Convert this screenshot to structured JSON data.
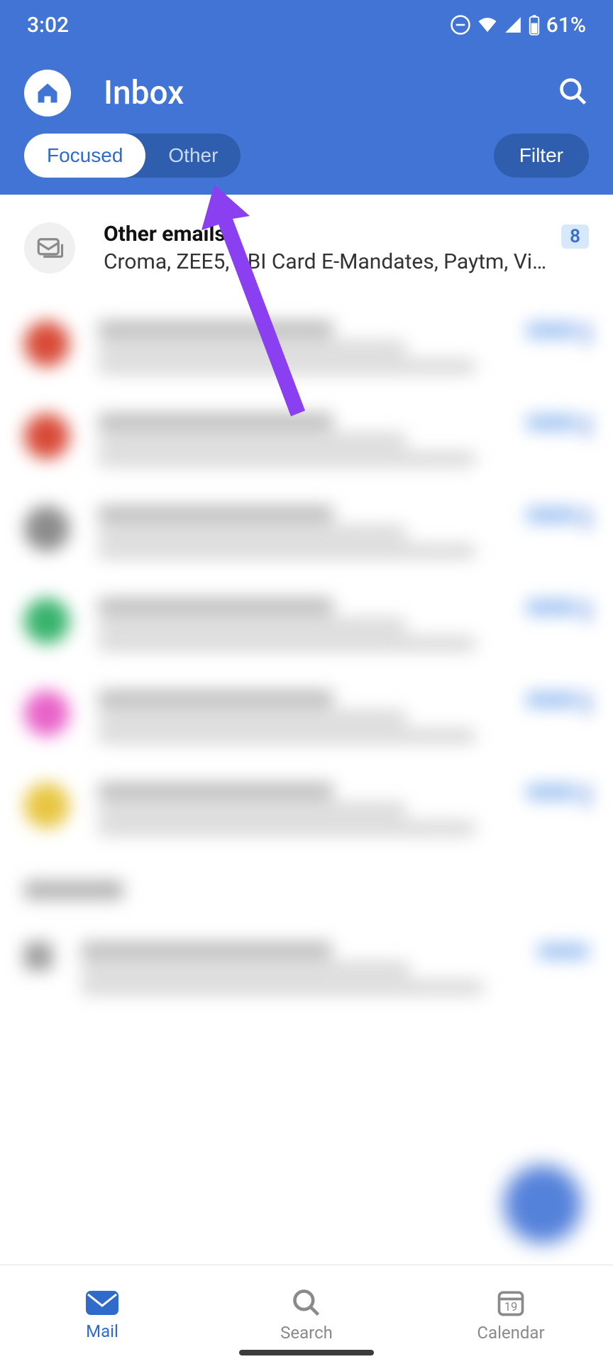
{
  "status": {
    "time": "3:02",
    "battery": "61%"
  },
  "header": {
    "title": "Inbox"
  },
  "tabs": {
    "focused": "Focused",
    "other": "Other",
    "filter": "Filter"
  },
  "other_emails": {
    "title": "Other emails",
    "preview": "Croma, ZEE5, SBI Card E-Mandates, Paytm, Vist…",
    "count": "8"
  },
  "mail_skeletons": [
    {
      "avatar": "#D84B38"
    },
    {
      "avatar": "#D84B38"
    },
    {
      "avatar": "#8C8C8C"
    },
    {
      "avatar": "#37B36C"
    },
    {
      "avatar": "#E863C8"
    },
    {
      "avatar": "#E8C642"
    }
  ],
  "nav": {
    "mail": "Mail",
    "search": "Search",
    "calendar": "Calendar",
    "cal_day": "19"
  }
}
